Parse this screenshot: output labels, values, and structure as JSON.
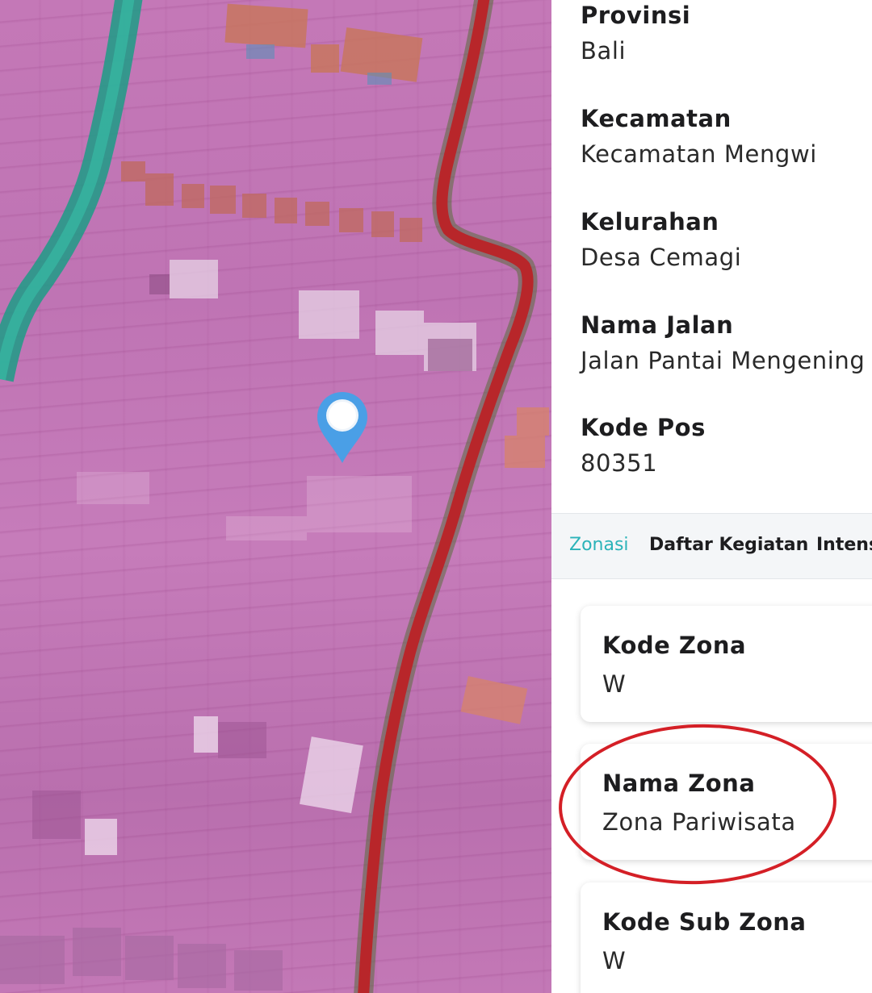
{
  "location": {
    "provinsi_label": "Provinsi",
    "provinsi_value": "Bali",
    "kecamatan_label": "Kecamatan",
    "kecamatan_value": "Kecamatan Mengwi",
    "kelurahan_label": "Kelurahan",
    "kelurahan_value": "Desa Cemagi",
    "nama_jalan_label": "Nama Jalan",
    "nama_jalan_value": "Jalan Pantai Mengening",
    "kode_pos_label": "Kode Pos",
    "kode_pos_value": "80351"
  },
  "tabs": [
    {
      "label": "Zonasi",
      "active": true
    },
    {
      "label": "Daftar Kegiatan",
      "active": false
    },
    {
      "label": "Intensitas",
      "active": false
    }
  ],
  "zone_cards": [
    {
      "label": "Kode Zona",
      "value": "W"
    },
    {
      "label": "Nama Zona",
      "value": "Zona Pariwisata"
    },
    {
      "label": "Kode Sub Zona",
      "value": "W"
    }
  ],
  "colors": {
    "map_zone_overlay": "#c47ab8",
    "road_boundary": "#b8262a",
    "river_boundary": "#1fa38e",
    "tab_active": "#2bb3b9",
    "annotation_circle": "#d41f26",
    "marker": "#4a9fe6"
  },
  "icons": {
    "marker": "map-pin-icon"
  }
}
